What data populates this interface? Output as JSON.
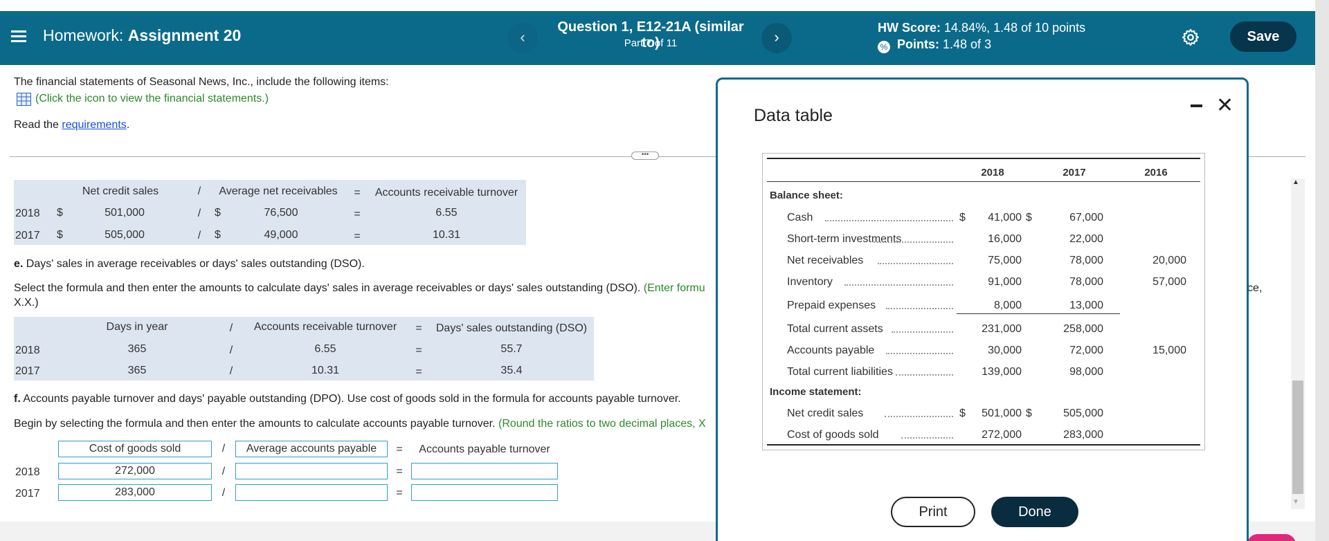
{
  "header": {
    "hw_prefix": "Homework:",
    "hw_name": "Assignment 20",
    "question_title": "Question 1, E12-21A (similar to)",
    "question_part": "Part 7 of 11",
    "score_label": "HW Score:",
    "score_value": "14.84%, 1.48 of 10 points",
    "points_label": "Points:",
    "points_value": "1.48 of 3",
    "save_label": "Save",
    "prev_glyph": "‹",
    "next_glyph": "›"
  },
  "intro": {
    "line1": "The financial statements of Seasonal News, Inc., include the following items:",
    "click_text": "(Click the icon to view the financial statements.)",
    "read_prefix": "Read the",
    "requirements_link": "requirements",
    "read_suffix": "."
  },
  "ar_table": {
    "headers": [
      "Net credit sales",
      "/",
      "Average net receivables",
      "=",
      "Accounts receivable turnover"
    ],
    "rows": [
      {
        "year": "2018",
        "cur1": "$",
        "sales": "501,000",
        "slash": "/",
        "cur2": "$",
        "avg": "76,500",
        "eq": "=",
        "turnover": "6.55"
      },
      {
        "year": "2017",
        "cur1": "$",
        "sales": "505,000",
        "slash": "/",
        "cur2": "$",
        "avg": "49,000",
        "eq": "=",
        "turnover": "10.31"
      }
    ]
  },
  "part_e": {
    "label": "e.",
    "title": "Days' sales in average receivables or days' sales outstanding (DSO).",
    "instruction": "Select the formula and then enter the amounts to calculate days' sales in average receivables or days' sales outstanding (DSO).",
    "hint": "(Enter formu",
    "hint_cont": "X.X.)",
    "right_fragment": "ce,",
    "headers": [
      "Days in year",
      "/",
      "Accounts receivable turnover",
      "=",
      "Days' sales outstanding (DSO)"
    ],
    "rows": [
      {
        "year": "2018",
        "days": "365",
        "slash": "/",
        "turnover": "6.55",
        "eq": "=",
        "dso": "55.7"
      },
      {
        "year": "2017",
        "days": "365",
        "slash": "/",
        "turnover": "10.31",
        "eq": "=",
        "dso": "35.4"
      }
    ]
  },
  "part_f": {
    "label": "f.",
    "title": "Accounts payable turnover and days' payable outstanding (DPO). Use cost of goods sold in the formula for accounts payable turnover.",
    "instruction": "Begin by selecting the formula and then enter the amounts to calculate accounts payable turnover.",
    "hint": "(Round the ratios to two decimal places, X",
    "headers": [
      "Cost of goods sold",
      "/",
      "Average accounts payable",
      "=",
      "Accounts payable turnover"
    ],
    "rows": [
      {
        "year": "2018",
        "cogs": "272,000",
        "slash": "/",
        "avg": "",
        "eq": "=",
        "turnover": ""
      },
      {
        "year": "2017",
        "cogs": "283,000",
        "slash": "/",
        "avg": "",
        "eq": "=",
        "turnover": ""
      }
    ]
  },
  "modal": {
    "title": "Data table",
    "print_label": "Print",
    "done_label": "Done",
    "close_glyph": "✕",
    "years": [
      "2018",
      "2017",
      "2016"
    ],
    "balance_heading": "Balance sheet:",
    "income_heading": "Income statement:",
    "balance_rows": [
      {
        "label": "Cash",
        "c1": "$",
        "v2018": "41,000",
        "c2": "$",
        "v2017": "67,000",
        "v2016": ""
      },
      {
        "label": "Short-term investments",
        "c1": "",
        "v2018": "16,000",
        "c2": "",
        "v2017": "22,000",
        "v2016": ""
      },
      {
        "label": "Net receivables",
        "c1": "",
        "v2018": "75,000",
        "c2": "",
        "v2017": "78,000",
        "v2016": "20,000"
      },
      {
        "label": "Inventory",
        "c1": "",
        "v2018": "91,000",
        "c2": "",
        "v2017": "78,000",
        "v2016": "57,000"
      },
      {
        "label": "Prepaid expenses",
        "c1": "",
        "v2018": "8,000",
        "c2": "",
        "v2017": "13,000",
        "v2016": ""
      },
      {
        "label": "Total current assets",
        "c1": "",
        "v2018": "231,000",
        "c2": "",
        "v2017": "258,000",
        "v2016": ""
      },
      {
        "label": "Accounts payable",
        "c1": "",
        "v2018": "30,000",
        "c2": "",
        "v2017": "72,000",
        "v2016": "15,000"
      },
      {
        "label": "Total current liabilities",
        "c1": "",
        "v2018": "139,000",
        "c2": "",
        "v2017": "98,000",
        "v2016": ""
      }
    ],
    "income_rows": [
      {
        "label": "Net credit sales",
        "c1": "$",
        "v2018": "501,000",
        "c2": "$",
        "v2017": "505,000",
        "v2016": ""
      },
      {
        "label": "Cost of goods sold",
        "c1": "",
        "v2018": "272,000",
        "c2": "",
        "v2017": "283,000",
        "v2016": ""
      }
    ]
  },
  "colors": {
    "header_bg": "#0b6a8a",
    "save_bg": "#07354b",
    "table_bg": "#dde5f0",
    "input_border": "#2aa0c8",
    "hint_green": "#2a8a2a",
    "link_blue": "#1a4fd6"
  }
}
